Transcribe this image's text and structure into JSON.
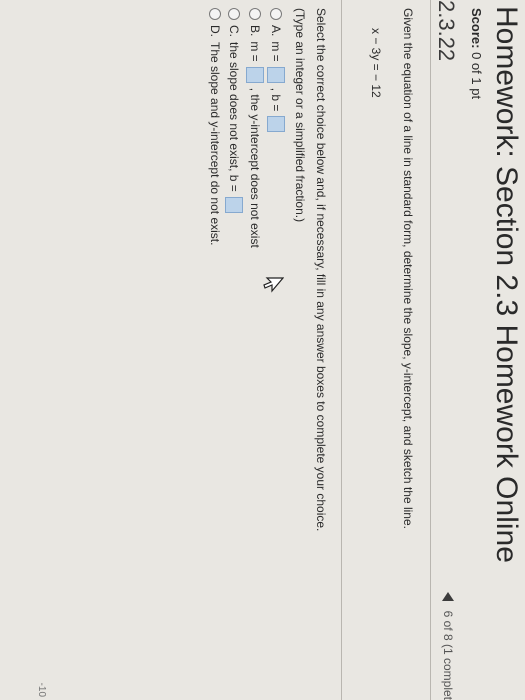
{
  "page": {
    "title": "Homework: Section 2.3 Homework Online",
    "score_label": "Score:",
    "score_value": "0 of 1 pt",
    "question_number": "2.3.22",
    "progress_text": "6 of 8 (1 complet",
    "edge_text": "-10"
  },
  "problem": {
    "prompt": "Given the equation of a line in standard form, determine the slope, y-intercept, and sketch the line.",
    "equation": "x − 3y = − 12",
    "instruction": "Select the correct choice below and, if necessary, fill in any answer boxes to complete your choice.",
    "hint": "(Type an integer or a simplified fraction.)"
  },
  "choices": {
    "a": {
      "letter": "A.",
      "m_label": "m =",
      "b_label": ", b ="
    },
    "b": {
      "letter": "B.",
      "m_label": "m =",
      "suffix": ", the y-intercept does not exist"
    },
    "c": {
      "letter": "C.",
      "text": "the slope does not exist, b ="
    },
    "d": {
      "letter": "D.",
      "text": "The slope and y-intercept do not exist."
    }
  },
  "icons": {
    "back": "triangle-left-icon",
    "pointer": "mouse-pointer-icon"
  }
}
